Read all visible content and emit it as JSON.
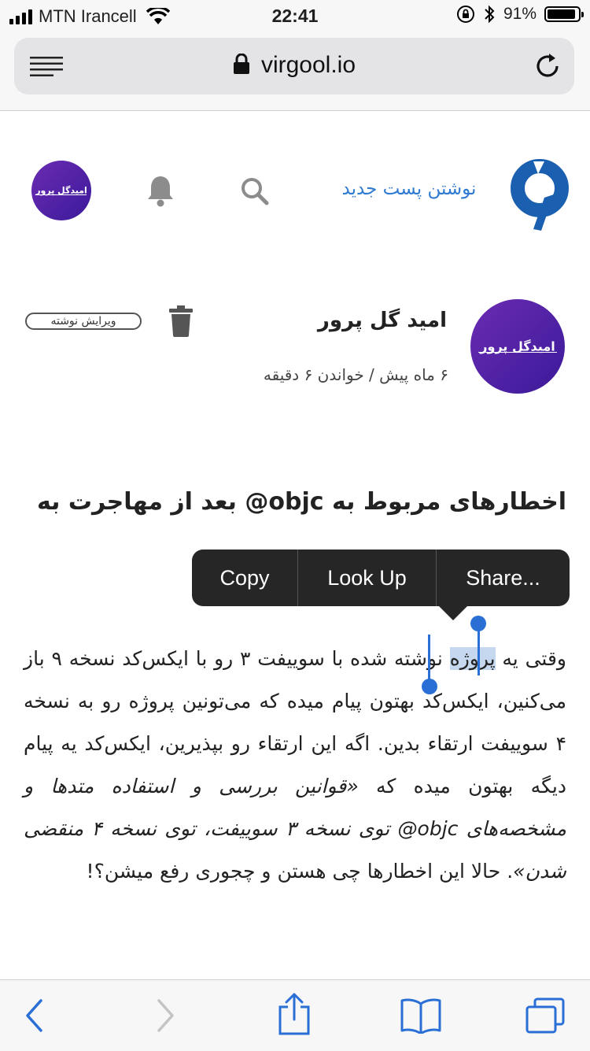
{
  "status_bar": {
    "carrier": "MTN Irancell",
    "time": "22:41",
    "battery_percent": "91%",
    "battery_level": 0.91
  },
  "browser": {
    "url": "virgool.io"
  },
  "site_header": {
    "new_post_label": "نوشتن پست جدید",
    "avatar_text": "امیدگل پرور"
  },
  "author": {
    "name": "امید گل پرور",
    "meta": "۶ ماه پیش / خواندن ۶ دقیقه",
    "avatar_text": "امیدگل پرور",
    "edit_label": "ویرایش نوشته"
  },
  "article": {
    "title": "اخطارهای مربوط به ‎@objc‎ بعد از مهاجرت به",
    "body": {
      "p1": "وقتی یه ",
      "selected": "پروژه",
      "p2": " نوشته شده با سوییفت ۳ رو با ایکس‌کد نسخه ۹ باز می‌کنین، ایکس‌کد بهتون پیام میده که می‌تونین پروژه رو به نسخه ۴ سوییفت ارتقاء بدین. اگه این ارتقاء رو بپذیرین، ایکس‌کد یه پیام دیگه بهتون میده که ",
      "italic": "«قوانین بررسی و استفاده متدها و مشخصه‌های ‎@objc‎ توی نسخه ۳ سوییفت، توی نسخه ۴ منقضی شدن»",
      "p3": ". حالا این اخطارها چی هستن و چجوری رفع میشن؟!"
    }
  },
  "context_menu": {
    "copy": "Copy",
    "look_up": "Look Up",
    "share": "Share..."
  },
  "colors": {
    "accent": "#2e7ad0",
    "selection": "#c5d8f0",
    "ios_blue": "#2a6fd6"
  }
}
